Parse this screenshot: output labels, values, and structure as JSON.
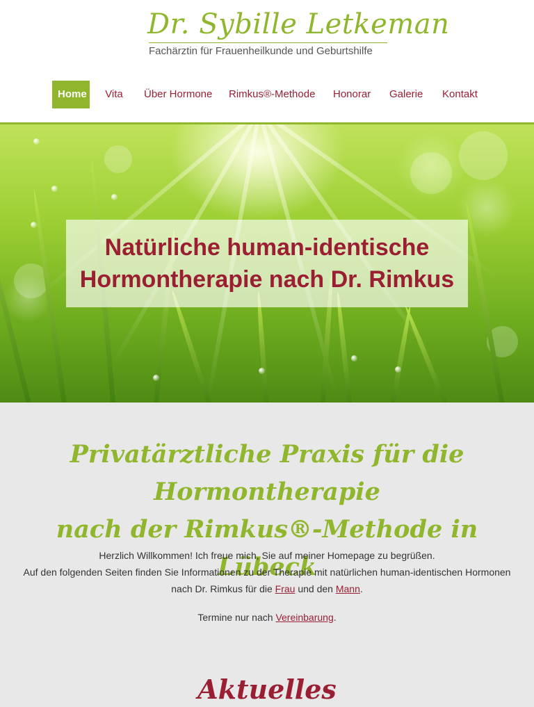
{
  "header": {
    "logo_name": "Dr. Sybille Letkeman",
    "logo_subtitle": "Fachärztin für Frauenheilkunde und Geburtshilfe"
  },
  "nav": {
    "items": [
      {
        "label": "Home",
        "active": true
      },
      {
        "label": "Vita"
      },
      {
        "label": "Über Hormone"
      },
      {
        "label": "Rimkus®-Methode"
      },
      {
        "label": "Honorar"
      },
      {
        "label": "Galerie"
      },
      {
        "label": "Kontakt"
      }
    ]
  },
  "hero": {
    "title_line1": "Natürliche human-identische",
    "title_line2": "Hormontherapie nach Dr. Rimkus"
  },
  "main": {
    "heading_line1": "Privatärztliche Praxis für die",
    "heading_line2": "Hormontherapie",
    "heading_line3": "nach der Rimkus®-Methode in Lübeck",
    "welcome": "Herzlich Willkommen! Ich freue mich, Sie auf meiner Homepage zu begrüßen.",
    "info_part1": "Auf den folgenden Seiten finden Sie Informationen zu der Therapie mit natürlichen human-identischen Hormonen nach Dr. Rimkus für die ",
    "link_frau": "Frau",
    "info_part2": " und den ",
    "link_mann": "Mann",
    "info_part3": ".",
    "appointment_text": "Termine nur nach ",
    "link_vereinbarung": "Vereinbarung",
    "appointment_end": ".",
    "news_heading": "Aktuelles"
  },
  "colors": {
    "accent_green": "#8fb62c",
    "accent_red": "#9a1f33",
    "background": "#e8e8e8"
  }
}
